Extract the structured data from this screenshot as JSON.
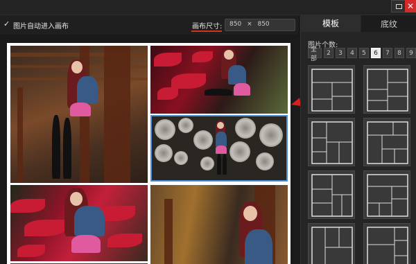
{
  "window": {
    "maximize_icon": "maximize-icon",
    "close_icon": "close-icon",
    "close_glyph": "✕"
  },
  "toolbar": {
    "checkbox_glyph": "✓",
    "auto_fit_label": "图片自动进入画布",
    "canvas_size_label": "画布尺寸:",
    "canvas_width": "850",
    "size_separator": "×",
    "canvas_height": "850",
    "accent_color": "#d5331e"
  },
  "panel": {
    "tabs": [
      {
        "label": "模板",
        "active": true
      },
      {
        "label": "底纹",
        "active": false
      }
    ],
    "count_label": "图片个数:",
    "count_options": [
      "全部",
      "2",
      "3",
      "4",
      "5",
      "6",
      "7",
      "8",
      "9"
    ],
    "selected_count": "6",
    "highlight_color": "#4a8fd8",
    "arrow_color": "#d8201c"
  }
}
